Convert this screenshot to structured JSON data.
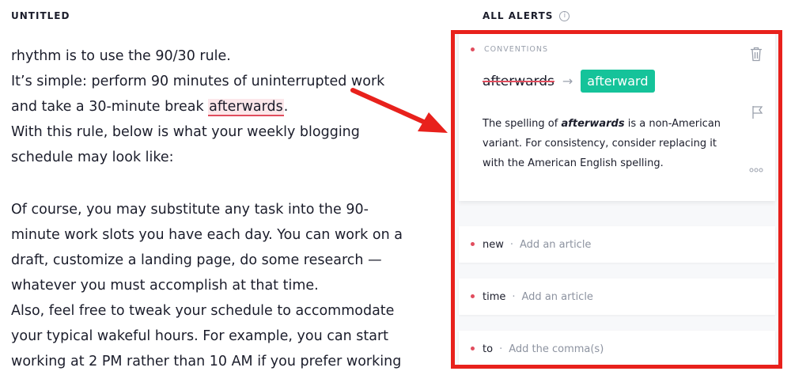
{
  "document": {
    "title": "UNTITLED",
    "lines": [
      "rhythm is to use the 90/30 rule.",
      "It’s simple: perform 90 minutes of uninterrupted work",
      "and take a 30-minute break ",
      "With this rule, below is what your weekly blogging",
      "schedule may look like:",
      "Of course, you may substitute any task into the 90-",
      "minute work slots you have each day. You can work on a",
      "draft, customize a landing page, do some research —",
      "whatever you must accomplish at that time.",
      "Also, feel free to tweak your schedule to accommodate",
      "your typical wakeful hours. For example, you can start",
      "working at 2 PM rather than 10 AM if you prefer working"
    ],
    "highlighted_word": "afterwards",
    "after_highlight": "."
  },
  "alerts": {
    "title": "ALL ALERTS",
    "info_icon": "i",
    "main_card": {
      "category": "CONVENTIONS",
      "original": "afterwards",
      "arrow": "→",
      "suggestion": "afterward",
      "explanation_before": "The spelling of ",
      "explanation_word": "afterwards",
      "explanation_after": " is a non-American variant. For consistency, consider replacing it with the American English spelling."
    },
    "items": [
      {
        "word": "new",
        "separator": "·",
        "hint": "Add an article"
      },
      {
        "word": "time",
        "separator": "·",
        "hint": "Add an article"
      },
      {
        "word": "to",
        "separator": "·",
        "hint": "Add the comma(s)"
      }
    ]
  },
  "colors": {
    "accent_green": "#15c39a",
    "alert_red": "#e14d5e",
    "annotation_red": "#e8211c"
  }
}
